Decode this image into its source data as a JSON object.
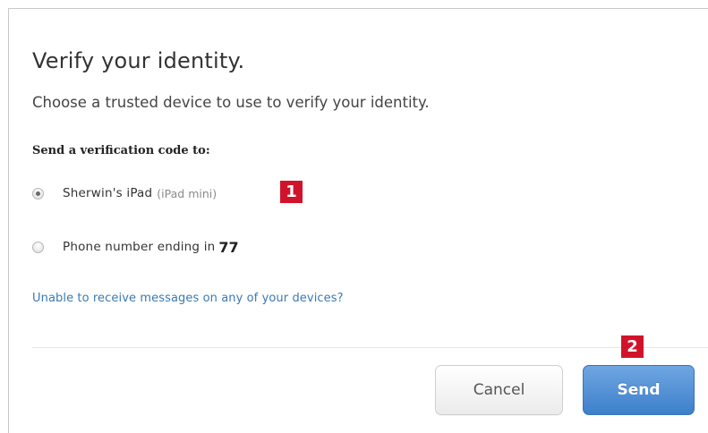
{
  "dialog": {
    "title": "Verify your identity.",
    "subtitle": "Choose a trusted device to use to verify your identity.",
    "send_to_label": "Send a verification code to:",
    "options": [
      {
        "label": "Sherwin's iPad",
        "sublabel": "(iPad mini)",
        "selected": true
      },
      {
        "label": "Phone number ending in",
        "suffix": "77",
        "selected": false
      }
    ],
    "help_link": "Unable to receive messages on any of your devices?",
    "cancel_label": "Cancel",
    "send_label": "Send"
  },
  "annotations": {
    "badge_1": "1",
    "badge_2": "2"
  },
  "colors": {
    "badge": "#d0132a",
    "link": "#3a79b5",
    "send_button": "#4a8bd3"
  },
  "icons": {
    "radio_selected": "radio-selected-icon",
    "radio_unselected": "radio-unselected-icon"
  }
}
